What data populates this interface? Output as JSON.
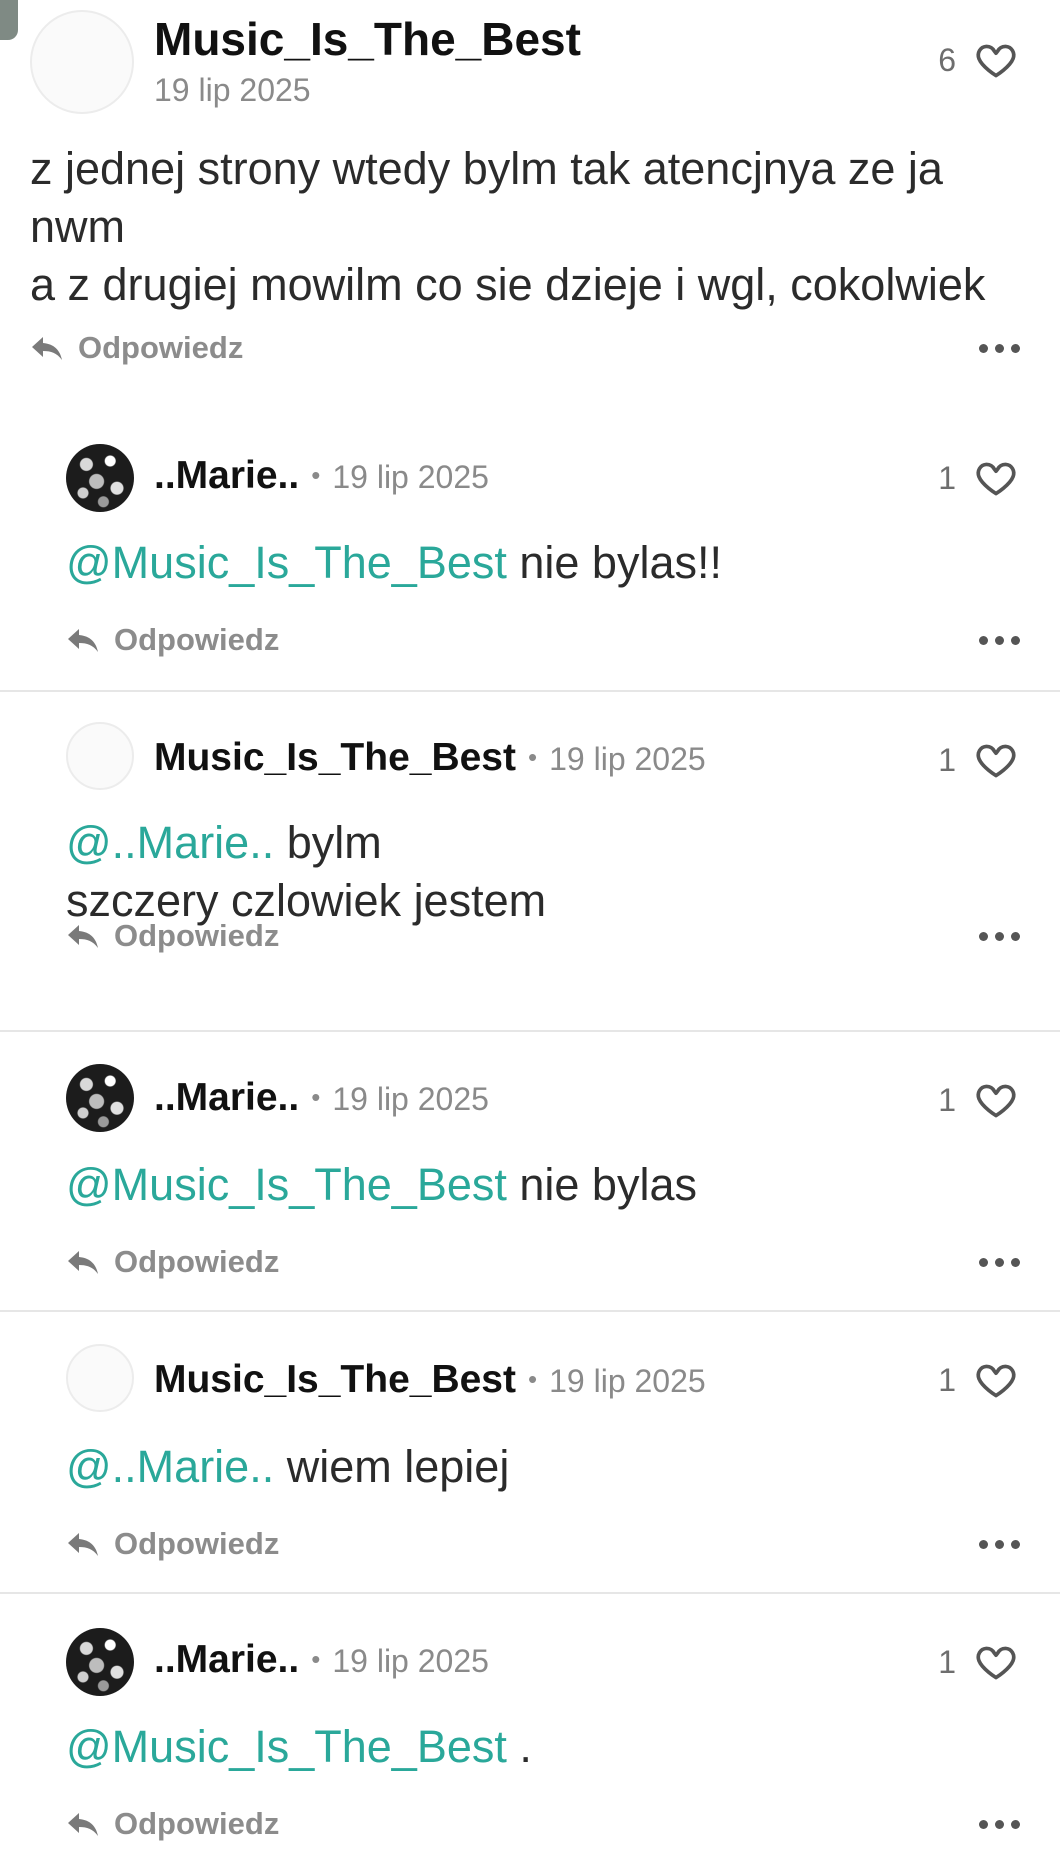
{
  "main": {
    "username": "Music_Is_The_Best",
    "date": "19 lip 2025",
    "likes": "6",
    "body_lines": [
      "z jednej strony wtedy bylm tak atencjnya ze ja",
      "nwm",
      "a z drugiej mowilm co sie dzieje i wgl, cokolwiek"
    ],
    "reply_label": "Odpowiedz"
  },
  "separator": "•",
  "replies": [
    {
      "username": "..Marie..",
      "date": "19 lip 2025",
      "likes": "1",
      "mention": "@Music_Is_The_Best",
      "text_lines": [
        "nie bylas!!"
      ],
      "reply_label": "Odpowiedz"
    },
    {
      "username": "Music_Is_The_Best",
      "date": "19 lip 2025",
      "likes": "1",
      "mention": "@..Marie..",
      "text_lines": [
        "bylm",
        "szczery czlowiek jestem"
      ],
      "reply_label": "Odpowiedz"
    },
    {
      "username": "..Marie..",
      "date": "19 lip 2025",
      "likes": "1",
      "mention": "@Music_Is_The_Best",
      "text_lines": [
        "nie bylas"
      ],
      "reply_label": "Odpowiedz"
    },
    {
      "username": "Music_Is_The_Best",
      "date": "19 lip 2025",
      "likes": "1",
      "mention": "@..Marie..",
      "text_lines": [
        "wiem lepiej"
      ],
      "reply_label": "Odpowiedz"
    },
    {
      "username": "..Marie..",
      "date": "19 lip 2025",
      "likes": "1",
      "mention": "@Music_Is_The_Best",
      "text_lines": [
        "."
      ],
      "reply_label": "Odpowiedz"
    }
  ],
  "colors": {
    "mention": "#2aa89a",
    "muted": "#8a8a8a",
    "divider": "#e6e6e6"
  },
  "icons": {
    "like": "heart-outline-icon",
    "reply": "reply-arrow-icon",
    "more": "more-horizontal-icon"
  }
}
